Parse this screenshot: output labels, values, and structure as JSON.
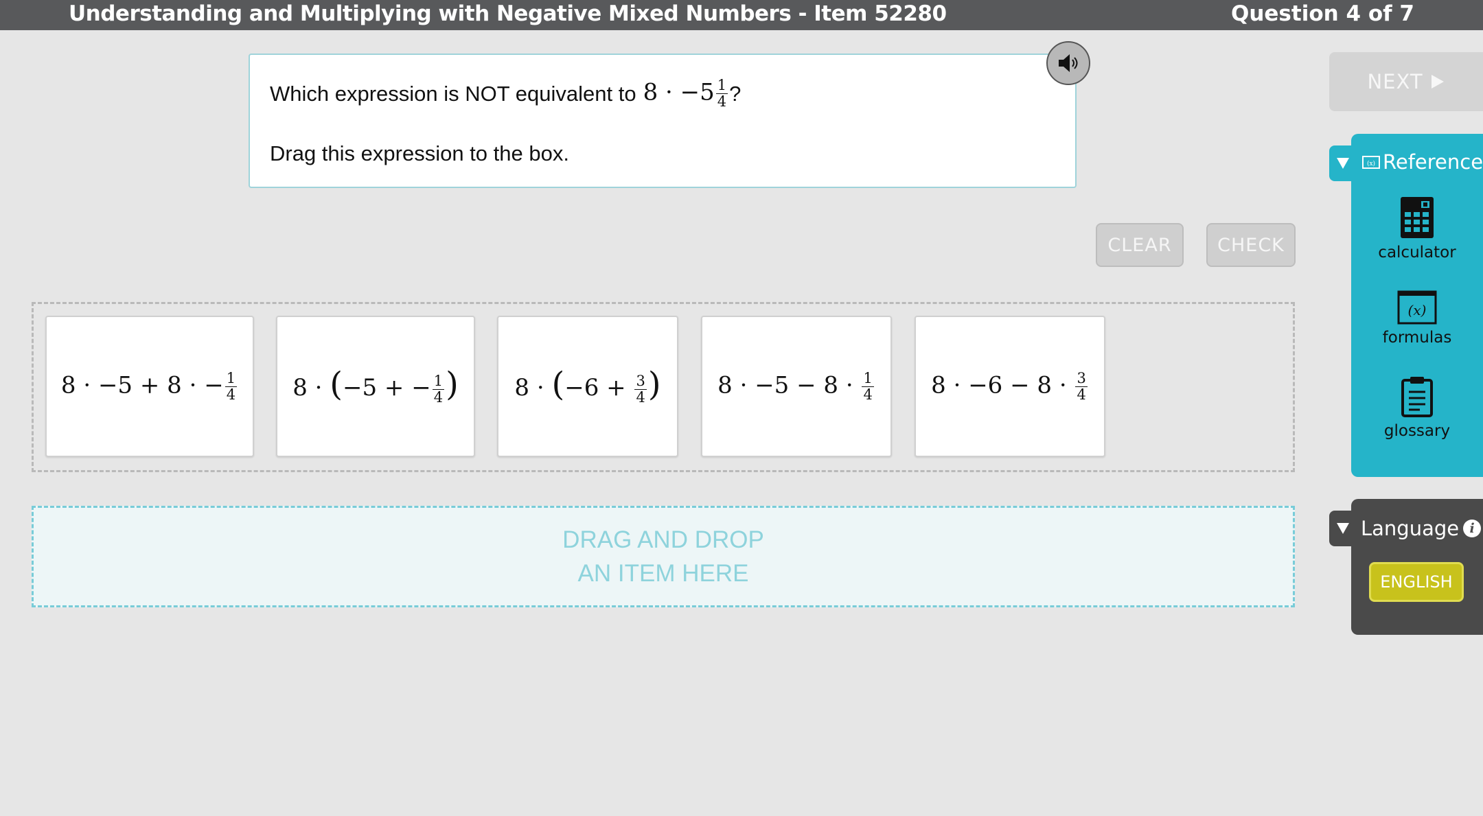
{
  "header": {
    "title": "Understanding and Multiplying with Negative Mixed Numbers - Item 52280",
    "question_counter": "Question 4 of 7"
  },
  "question": {
    "prompt_prefix": "Which expression is NOT equivalent to",
    "prompt_suffix": "?",
    "instruction": "Drag this expression to the box."
  },
  "actions": {
    "clear_label": "CLEAR",
    "check_label": "CHECK",
    "next_label": "NEXT"
  },
  "tiles": [
    {
      "expression": "8 · −5 + 8 · −1/4"
    },
    {
      "expression": "8 · (−5 + −1/4)"
    },
    {
      "expression": "8 · (−6 + 3/4)"
    },
    {
      "expression": "8 · −5 − 8 · 1/4"
    },
    {
      "expression": "8 · −6 − 8 · 3/4"
    }
  ],
  "drop_zone": {
    "line1": "DRAG AND DROP",
    "line2": "AN ITEM HERE"
  },
  "reference": {
    "title": "Reference",
    "items": [
      {
        "label": "calculator",
        "icon": "calculator-icon"
      },
      {
        "label": "formulas",
        "icon": "formulas-icon"
      },
      {
        "label": "glossary",
        "icon": "glossary-icon"
      }
    ]
  },
  "language": {
    "title": "Language",
    "selected": "ENGLISH"
  },
  "colors": {
    "teal": "#25b4c9",
    "topbar": "#58595b",
    "english_button": "#c8c21c"
  }
}
